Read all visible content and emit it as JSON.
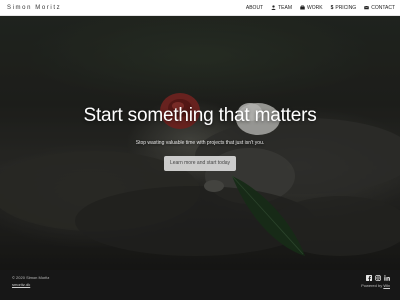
{
  "navbar": {
    "brand": "Simon Moritz",
    "items": [
      {
        "label": "ABOUT",
        "icon": ""
      },
      {
        "label": "TEAM",
        "icon": "user-icon"
      },
      {
        "label": "WORK",
        "icon": "briefcase-icon"
      },
      {
        "label": "PRICING",
        "icon": "dollar-icon"
      },
      {
        "label": "CONTACT",
        "icon": "envelope-icon"
      }
    ]
  },
  "hero": {
    "title": "Start something that matters",
    "subtitle": "Stop wasting valuable time with projects that just isn't you.",
    "cta_label": "Learn more and start today"
  },
  "footer": {
    "copyright": "© 2020 Simon Moritz",
    "site_link": "smoritz.dk",
    "social_icons": [
      "facebook-icon",
      "instagram-icon",
      "linkedin-icon"
    ],
    "powered_prefix": "Powered by",
    "powered_link": "Wix"
  },
  "colors": {
    "navbar_bg": "#ffffff",
    "footer_bg": "#171717",
    "button_bg": "#e1e1e1"
  }
}
